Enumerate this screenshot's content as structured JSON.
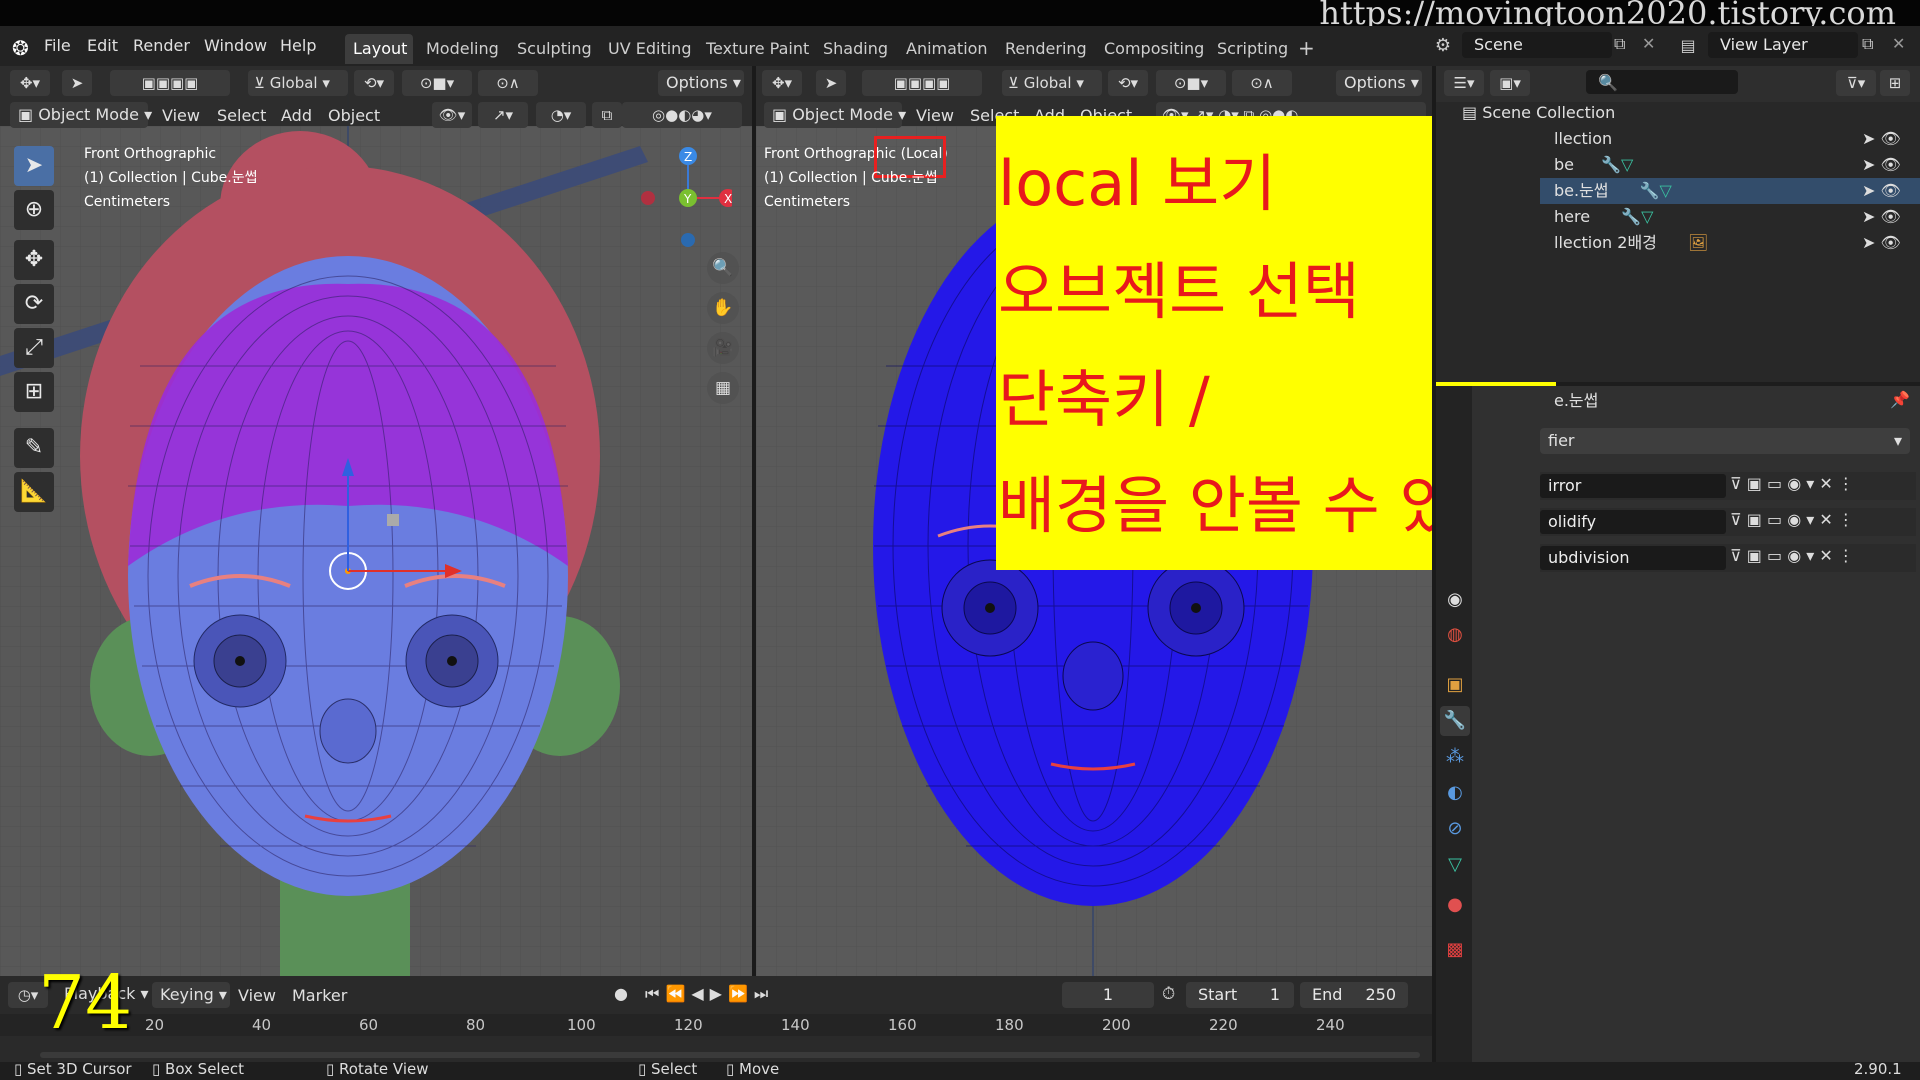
{
  "watermark": "https://movingtoon2020.tistory.com",
  "menu": [
    "File",
    "Edit",
    "Render",
    "Window",
    "Help"
  ],
  "workspaces": [
    "Layout",
    "Modeling",
    "Sculpting",
    "UV Editing",
    "Texture Paint",
    "Shading",
    "Animation",
    "Rendering",
    "Compositing",
    "Scripting"
  ],
  "scene": {
    "label": "Scene",
    "view_layer": "View Layer"
  },
  "viewport_left": {
    "orientation": "Global",
    "options": "Options",
    "mode": "Object Mode",
    "menus": [
      "View",
      "Select",
      "Add",
      "Object"
    ],
    "info": [
      "Front Orthographic",
      "(1) Collection | Cube.눈썹",
      "Centimeters"
    ]
  },
  "viewport_right": {
    "orientation": "Global",
    "options": "Options",
    "mode": "Object Mode",
    "menus": [
      "View",
      "Select",
      "Add",
      "Object"
    ],
    "info": [
      "Front Orthographic (Local)",
      "(1) Collection | Cube.눈썹",
      "Centimeters"
    ]
  },
  "gizmo": {
    "z": "Z",
    "y": "Y",
    "x": "X"
  },
  "outliner": {
    "root": "Scene Collection",
    "rows": [
      "llection",
      "be",
      "be.눈썹",
      "here",
      "llection 2배경"
    ]
  },
  "properties": {
    "object": "e.눈썹",
    "add_modifier": "fier",
    "modifiers": [
      "irror",
      "olidify",
      "ubdivision"
    ]
  },
  "annotation": {
    "lines": [
      "local 보기",
      "오브젝트 선택",
      "단축키 /",
      "배경을 안볼 수 있다"
    ],
    "bg": "#ffff00",
    "fg": "#e8181c"
  },
  "timeline": {
    "playback": "Playback",
    "keying": "Keying",
    "view": "View",
    "marker": "Marker",
    "current": "1",
    "start_label": "Start",
    "start": "1",
    "end_label": "End",
    "end": "250",
    "ticks": [
      "20",
      "40",
      "60",
      "80",
      "100",
      "120",
      "140",
      "160",
      "180",
      "200",
      "220",
      "240"
    ]
  },
  "frame_badge": "74",
  "statusbar": {
    "items": [
      "Set 3D Cursor",
      "Box Select",
      "Rotate View",
      "Select",
      "Move"
    ],
    "version": "2.90.1"
  }
}
